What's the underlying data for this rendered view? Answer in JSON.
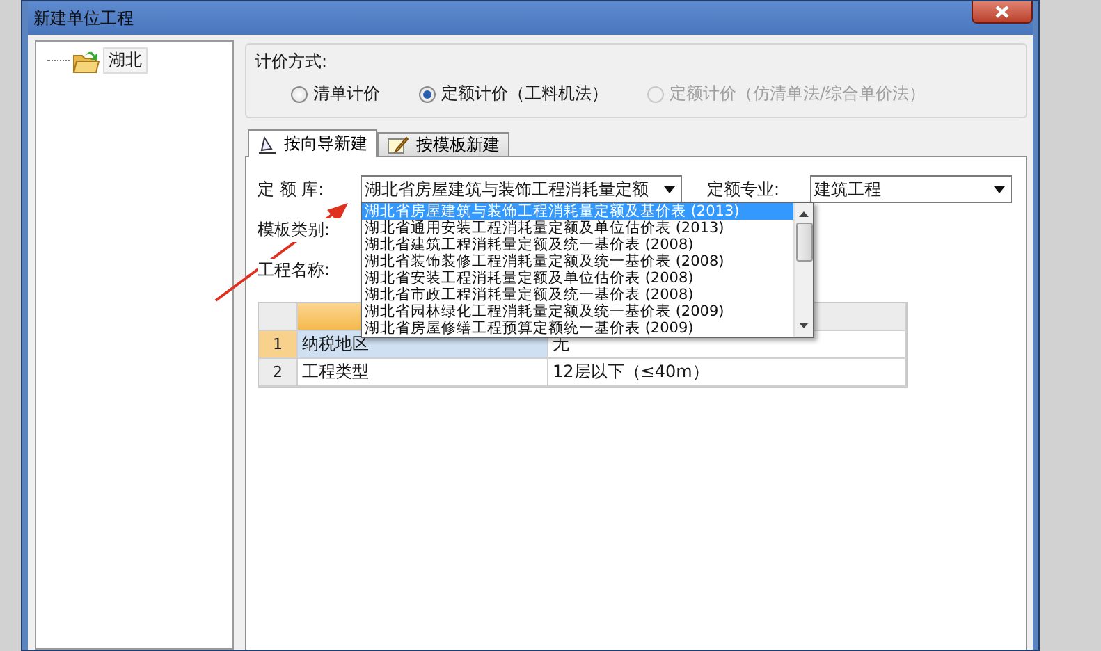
{
  "window": {
    "title": "新建单位工程"
  },
  "tree": {
    "items": [
      {
        "label": "湖北",
        "selected": false
      }
    ]
  },
  "pricing_method": {
    "label": "计价方式:",
    "options": [
      {
        "label": "清单计价",
        "selected": false,
        "disabled": false
      },
      {
        "label": "定额计价（工料机法）",
        "selected": true,
        "disabled": false
      },
      {
        "label": "定额计价（仿清单法/综合单价法）",
        "selected": false,
        "disabled": true
      }
    ]
  },
  "tabs": [
    {
      "label": "按向导新建",
      "selected": true,
      "kind": "wizard"
    },
    {
      "label": "按模板新建",
      "selected": false,
      "kind": "template"
    }
  ],
  "form": {
    "quota_library": {
      "label": "定 额 库:",
      "value": "湖北省房屋建筑与装饰工程消耗量定额"
    },
    "specialty": {
      "label": "定额专业:",
      "value": "建筑工程"
    },
    "template_type": {
      "label": "模板类别:"
    },
    "project_name": {
      "label": "工程名称:"
    }
  },
  "dropdown": {
    "items": [
      {
        "label": "湖北省房屋建筑与装饰工程消耗量定额及基价表 (2013)",
        "selected": true
      },
      {
        "label": "湖北省通用安装工程消耗量定额及单位估价表 (2013)",
        "selected": false
      },
      {
        "label": "湖北省建筑工程消耗量定额及统一基价表 (2008)",
        "selected": false
      },
      {
        "label": "湖北省装饰装修工程消耗量定额及统一基价表 (2008)",
        "selected": false
      },
      {
        "label": "湖北省安装工程消耗量定额及单位估价表 (2008)",
        "selected": false
      },
      {
        "label": "湖北省市政工程消耗量定额及统一基价表 (2008)",
        "selected": false
      },
      {
        "label": "湖北省园林绿化工程消耗量定额及统一基价表 (2009)",
        "selected": false
      },
      {
        "label": "湖北省房屋修缮工程预算定额统一基价表 (2009)",
        "selected": false
      }
    ]
  },
  "grid": {
    "rows": [
      {
        "number": "1",
        "name": "纳税地区",
        "value": "无",
        "selected": true
      },
      {
        "number": "2",
        "name": "工程类型",
        "value": "12层以下（≤40m）",
        "selected": false
      }
    ]
  }
}
